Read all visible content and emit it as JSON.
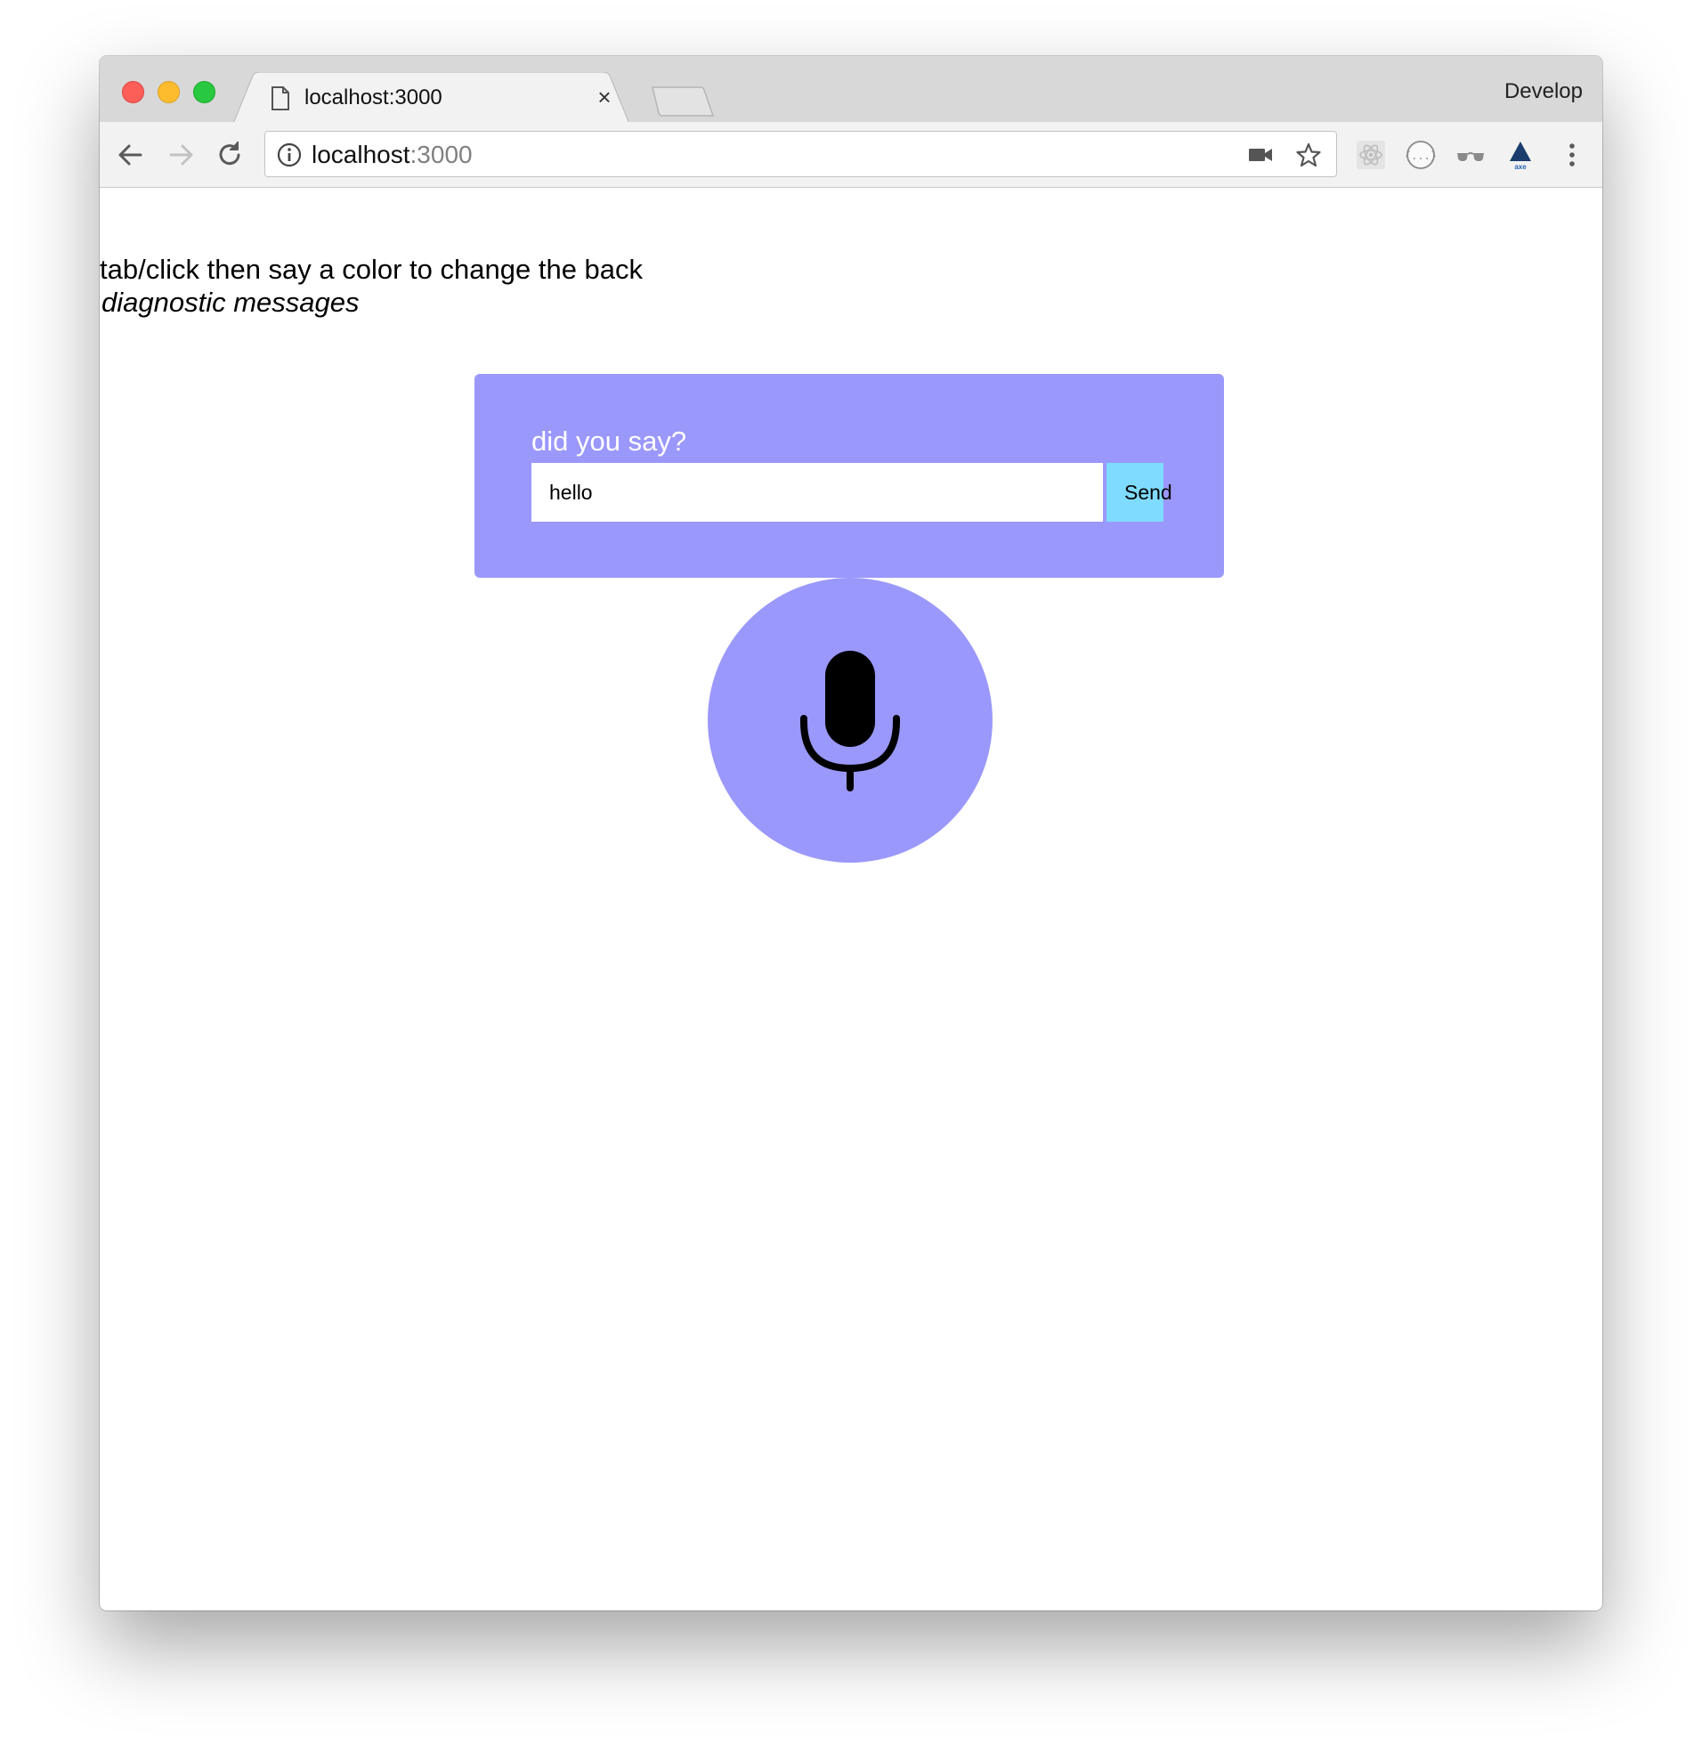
{
  "browser": {
    "tab_title": "localhost:3000",
    "tab_close": "×",
    "menu_right": "Develop",
    "url_host": "localhost",
    "url_port": ":3000",
    "icons": {
      "back": "back-arrow-icon",
      "forward": "forward-arrow-icon",
      "reload": "reload-icon",
      "site_info": "info-icon",
      "camera": "video-camera-icon",
      "bookmark": "star-icon",
      "ext_react": "react-devtools-icon",
      "ext_braces": "json-braces-icon",
      "ext_glasses": "glasses-icon",
      "ext_axe": "axe-icon",
      "menu": "kebab-menu-icon"
    }
  },
  "page": {
    "instructions": "tab/click then say a color to change the back",
    "diagnostic": "diagnostic messages",
    "panel": {
      "label": "did you say?",
      "input_value": "hello",
      "send_label": "Send"
    },
    "mic_icon": "microphone-icon"
  },
  "colors": {
    "panel_bg": "#9a98fb",
    "send_bg": "#7fdbff",
    "mic_bg": "#9a98fb"
  }
}
